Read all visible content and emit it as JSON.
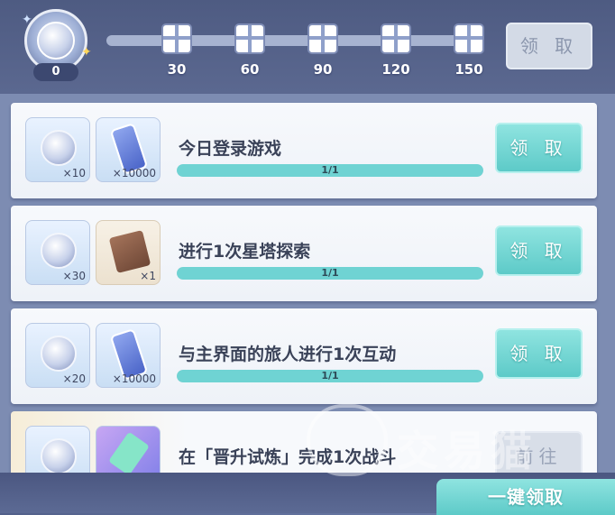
{
  "header": {
    "points": "0",
    "progress_percent": 0,
    "milestones": [
      {
        "label": "30"
      },
      {
        "label": "60"
      },
      {
        "label": "90"
      },
      {
        "label": "120"
      },
      {
        "label": "150"
      }
    ],
    "claim_label": "领 取"
  },
  "tasks": [
    {
      "title": "今日登录游戏",
      "progress": "1/1",
      "progress_fraction": 1,
      "claim_label": "领 取",
      "rewards": [
        {
          "icon": "star-coin-icon",
          "qty": "×10"
        },
        {
          "icon": "ticket-icon",
          "qty": "×10000"
        }
      ]
    },
    {
      "title": "进行1次星塔探索",
      "progress": "1/1",
      "progress_fraction": 1,
      "claim_label": "领 取",
      "rewards": [
        {
          "icon": "star-coin-icon",
          "qty": "×30"
        },
        {
          "icon": "book-icon",
          "qty": "×1"
        }
      ]
    },
    {
      "title": "与主界面的旅人进行1次互动",
      "progress": "1/1",
      "progress_fraction": 1,
      "claim_label": "领 取",
      "rewards": [
        {
          "icon": "star-coin-icon",
          "qty": "×20"
        },
        {
          "icon": "ticket-icon",
          "qty": "×10000"
        }
      ]
    },
    {
      "title": "在「晋升试炼」完成1次战斗",
      "claim_label": "前往",
      "rewards": [
        {
          "icon": "star-coin-icon"
        },
        {
          "icon": "crystal-icon"
        }
      ]
    }
  ],
  "footer": {
    "claim_all_label": "一键领取"
  },
  "watermark": "交易猫"
}
